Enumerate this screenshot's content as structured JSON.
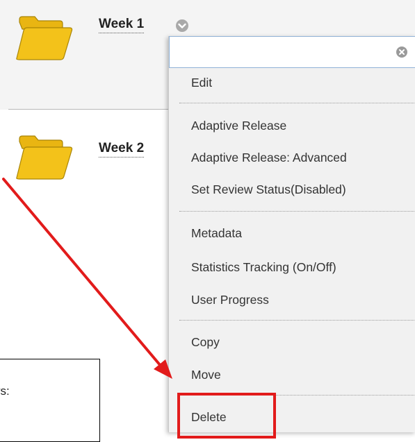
{
  "rows": [
    {
      "title": "Week 1",
      "selected": true
    },
    {
      "title": "Week 2",
      "selected": false
    }
  ],
  "menu": {
    "search_value": "",
    "clear_icon": "clear-circle-icon",
    "groups": [
      [
        "Edit"
      ],
      [
        "Adaptive Release",
        "Adaptive Release: Advanced",
        "Set Review Status(Disabled)"
      ],
      [
        "Metadata",
        "Statistics Tracking (On/Off)",
        "User Progress"
      ],
      [
        "Copy",
        "Move"
      ],
      [
        "Delete"
      ]
    ]
  },
  "instruction": {
    "text": "ys:"
  },
  "colors": {
    "annotation_red": "#e21b1b",
    "folder_yellow": "#f3c21a",
    "selected_row_bg": "#f4f4f4",
    "menu_bg": "#f1f1f1"
  },
  "icons": [
    "folder-icon",
    "chevron-down-icon",
    "clear-circle-icon",
    "arrow-icon"
  ]
}
